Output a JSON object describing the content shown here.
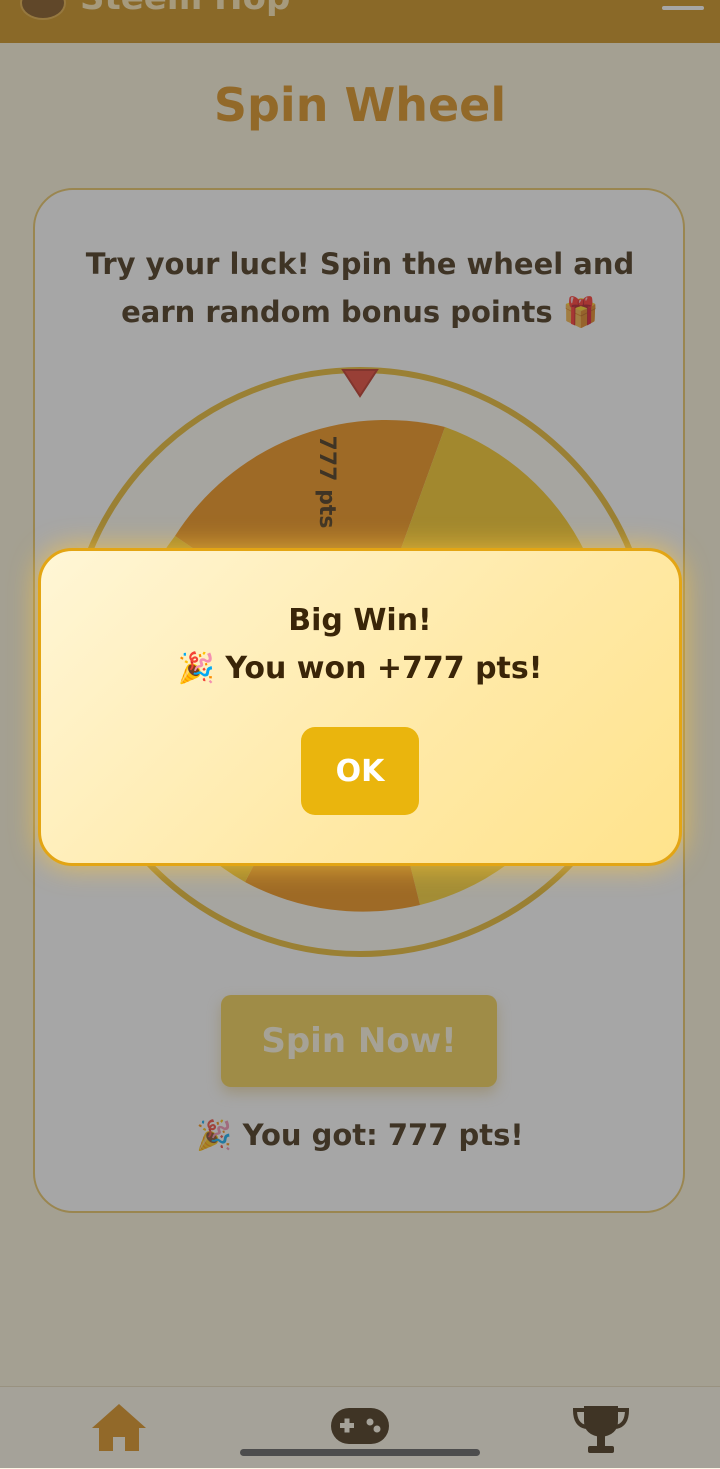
{
  "header": {
    "app_name": "Steem Hop",
    "logo_icon": "app-logo-icon",
    "menu_icon": "hamburger-menu-icon"
  },
  "page": {
    "title": "Spin Wheel"
  },
  "card": {
    "intro": "Try your luck! Spin the wheel and earn random bonus points 🎁",
    "wheel_segment_label": "777 pts",
    "spin_button_label": "Spin Now!",
    "result_text": "🎉 You got: 777 pts!"
  },
  "modal": {
    "title": "Big Win!",
    "message": "🎉 You won +777 pts!",
    "ok_label": "OK"
  },
  "bottom_nav": {
    "items": [
      {
        "icon": "home-icon",
        "color": "#d98a10"
      },
      {
        "icon": "gamepad-icon",
        "color": "#3a2508"
      },
      {
        "icon": "trophy-icon",
        "color": "#3a2508"
      }
    ]
  },
  "colors": {
    "header": "#c98a0e",
    "accent": "#eab50d",
    "text": "#3a2508",
    "wheel_orange": "#f08c0a",
    "wheel_yellow": "#f7c51a",
    "pointer": "#e53b2a"
  }
}
